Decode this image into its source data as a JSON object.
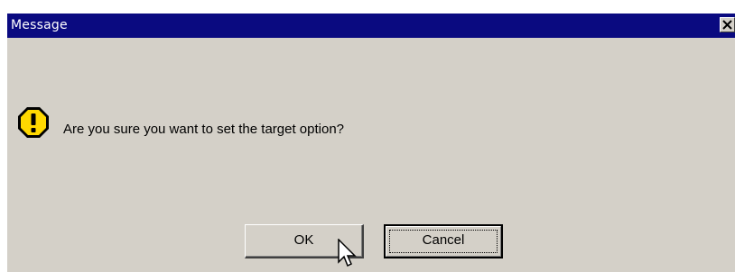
{
  "window": {
    "title": "Message",
    "title_bar_color": "#0a0a80",
    "body_color": "#d4d0c8"
  },
  "icons": {
    "close": "close-icon",
    "warning": "warning-icon",
    "cursor": "mouse-pointer-icon"
  },
  "dialog": {
    "message": "Are you sure you want to set the target option?",
    "ok_label": "OK",
    "cancel_label": "Cancel",
    "focused_button": "Cancel"
  }
}
